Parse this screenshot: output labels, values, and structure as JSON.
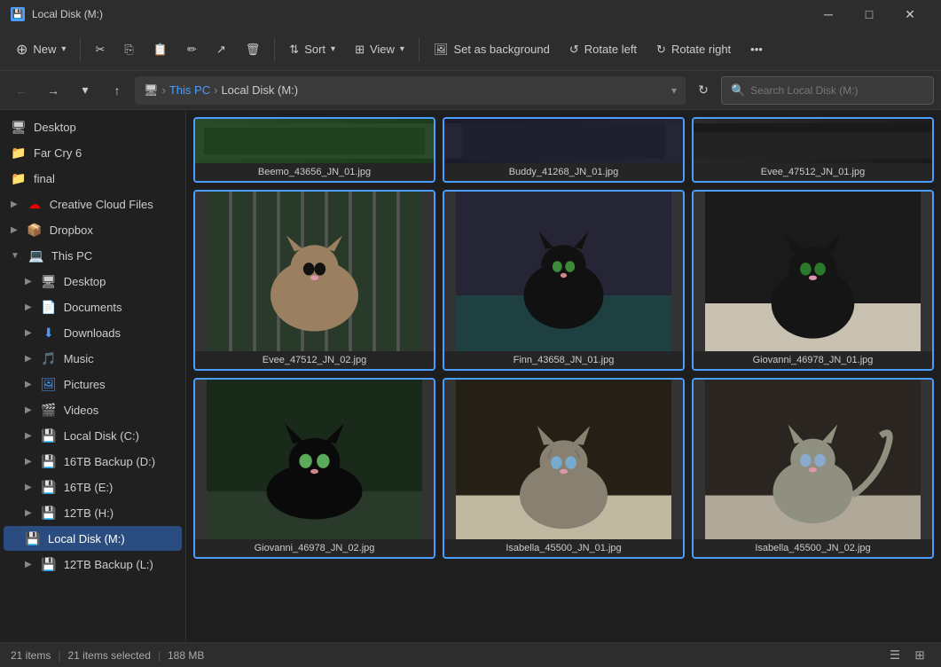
{
  "window": {
    "title": "Local Disk (M:)",
    "icon": "💾"
  },
  "toolbar": {
    "new_label": "New",
    "sort_label": "Sort",
    "view_label": "View",
    "set_background_label": "Set as background",
    "rotate_left_label": "Rotate left",
    "rotate_right_label": "Rotate right"
  },
  "addressbar": {
    "this_pc": "This PC",
    "local_disk": "Local Disk (M:)",
    "search_placeholder": "Search Local Disk (M:)"
  },
  "sidebar": {
    "items": [
      {
        "id": "desktop-top",
        "label": "Desktop",
        "icon": "🖥",
        "indent": 0,
        "expanded": false
      },
      {
        "id": "far-cry",
        "label": "Far Cry 6",
        "icon": "📁",
        "indent": 0,
        "expanded": false
      },
      {
        "id": "final",
        "label": "final",
        "icon": "📁",
        "indent": 0,
        "expanded": false
      },
      {
        "id": "creative-cloud",
        "label": "Creative Cloud Files",
        "icon": "☁",
        "indent": 0,
        "expanded": false,
        "arrow": "▶"
      },
      {
        "id": "dropbox",
        "label": "Dropbox",
        "icon": "📦",
        "indent": 0,
        "expanded": false,
        "arrow": "▶"
      },
      {
        "id": "this-pc",
        "label": "This PC",
        "icon": "💻",
        "indent": 0,
        "expanded": true,
        "arrow": "▼"
      },
      {
        "id": "desktop",
        "label": "Desktop",
        "icon": "🖥",
        "indent": 1,
        "expanded": false,
        "arrow": "▶"
      },
      {
        "id": "documents",
        "label": "Documents",
        "icon": "📄",
        "indent": 1,
        "expanded": false,
        "arrow": "▶"
      },
      {
        "id": "downloads",
        "label": "Downloads",
        "icon": "⬇",
        "indent": 1,
        "expanded": false,
        "arrow": "▶"
      },
      {
        "id": "music",
        "label": "Music",
        "icon": "🎵",
        "indent": 1,
        "expanded": false,
        "arrow": "▶"
      },
      {
        "id": "pictures",
        "label": "Pictures",
        "icon": "🖼",
        "indent": 1,
        "expanded": false,
        "arrow": "▶"
      },
      {
        "id": "videos",
        "label": "Videos",
        "icon": "🎬",
        "indent": 1,
        "expanded": false,
        "arrow": "▶"
      },
      {
        "id": "local-c",
        "label": "Local Disk (C:)",
        "icon": "💾",
        "indent": 1,
        "expanded": false,
        "arrow": "▶"
      },
      {
        "id": "backup-d",
        "label": "16TB Backup (D:)",
        "icon": "💾",
        "indent": 1,
        "expanded": false,
        "arrow": "▶"
      },
      {
        "id": "16tb-e",
        "label": "16TB (E:)",
        "icon": "💾",
        "indent": 1,
        "expanded": false,
        "arrow": "▶"
      },
      {
        "id": "12tb-h",
        "label": "12TB (H:)",
        "icon": "💾",
        "indent": 1,
        "expanded": false,
        "arrow": "▶"
      },
      {
        "id": "local-m",
        "label": "Local Disk (M:)",
        "icon": "💾",
        "indent": 1,
        "expanded": false,
        "active": true
      },
      {
        "id": "12tb-backup",
        "label": "12TB Backup (L:)",
        "icon": "💾",
        "indent": 1,
        "expanded": false,
        "arrow": "▶"
      }
    ]
  },
  "files": [
    {
      "id": "beemo",
      "name": "Beemo_43656_JN_01.jpg",
      "thumb_class": "thumb-beemo",
      "partial": true
    },
    {
      "id": "buddy",
      "name": "Buddy_41268_JN_01.jpg",
      "thumb_class": "thumb-buddy",
      "partial": true
    },
    {
      "id": "evee1",
      "name": "Evee_47512_JN_01.jpg",
      "thumb_class": "thumb-evee1",
      "partial": true
    },
    {
      "id": "evee2",
      "name": "Evee_47512_JN_02.jpg",
      "thumb_class": "thumb-evee2",
      "partial": false
    },
    {
      "id": "finn",
      "name": "Finn_43658_JN_01.jpg",
      "thumb_class": "thumb-finn",
      "partial": false
    },
    {
      "id": "giovanni1",
      "name": "Giovanni_46978_JN_01.jpg",
      "thumb_class": "thumb-giovanni1",
      "partial": false
    },
    {
      "id": "giovanni2",
      "name": "Giovanni_46978_JN_02.jpg",
      "thumb_class": "thumb-giovanni2",
      "partial": false
    },
    {
      "id": "isabella1",
      "name": "Isabella_45500_JN_01.jpg",
      "thumb_class": "thumb-isabella1",
      "partial": false
    },
    {
      "id": "isabella2",
      "name": "Isabella_45500_JN_02.jpg",
      "thumb_class": "thumb-isabella2",
      "partial": false
    }
  ],
  "statusbar": {
    "items_count": "21 items",
    "selected_count": "21 items selected",
    "size": "188 MB"
  }
}
